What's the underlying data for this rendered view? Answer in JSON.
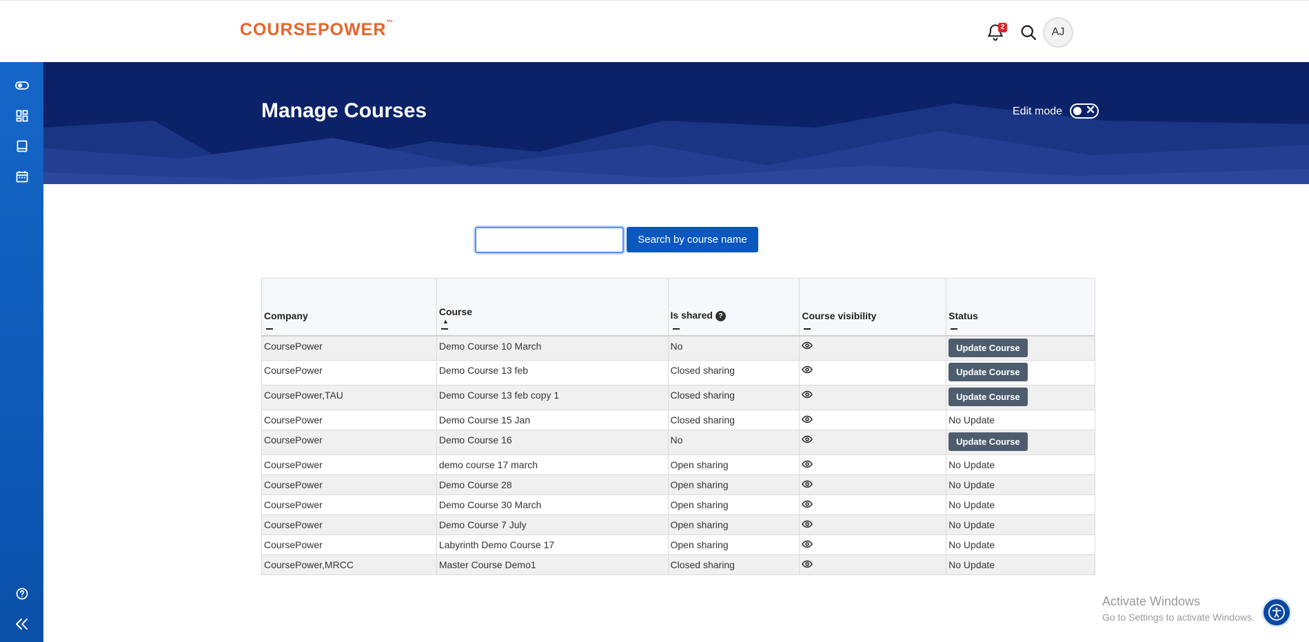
{
  "header": {
    "logo_text": "COURSEPOWER",
    "logo_tm": "™",
    "notification_count": "2",
    "user_initials": "AJ",
    "brand_color": "#e8632b"
  },
  "sidebar": {
    "icons": [
      "toggle-icon",
      "dashboard-icon",
      "book-icon",
      "calendar-icon",
      "help-icon",
      "collapse-icon"
    ]
  },
  "banner": {
    "title": "Manage Courses",
    "edit_mode_label": "Edit mode"
  },
  "search": {
    "placeholder": "",
    "button_label": "Search by course name"
  },
  "table": {
    "columns": [
      "Company",
      "Course",
      "Is shared",
      "Course visibility",
      "Status"
    ],
    "sorted_column": "Course",
    "rows": [
      {
        "company": "CoursePower",
        "course": "Demo Course 10 March",
        "shared": "No",
        "status": "Update Course",
        "status_button": true
      },
      {
        "company": "CoursePower",
        "course": "Demo Course 13 feb",
        "shared": "Closed sharing",
        "status": "Update Course",
        "status_button": true
      },
      {
        "company": "CoursePower,TAU",
        "course": "Demo Course 13 feb copy 1",
        "shared": "Closed sharing",
        "status": "Update Course",
        "status_button": true
      },
      {
        "company": "CoursePower",
        "course": "Demo Course 15 Jan",
        "shared": "Closed sharing",
        "status": "No Update",
        "status_button": false
      },
      {
        "company": "CoursePower",
        "course": "Demo Course 16",
        "shared": "No",
        "status": "Update Course",
        "status_button": true
      },
      {
        "company": "CoursePower",
        "course": "demo course 17 march",
        "shared": "Open sharing",
        "status": "No Update",
        "status_button": false
      },
      {
        "company": "CoursePower",
        "course": "Demo Course 28",
        "shared": "Open sharing",
        "status": "No Update",
        "status_button": false
      },
      {
        "company": "CoursePower",
        "course": "Demo Course 30 March",
        "shared": "Open sharing",
        "status": "No Update",
        "status_button": false
      },
      {
        "company": "CoursePower",
        "course": "Demo Course 7 July",
        "shared": "Open sharing",
        "status": "No Update",
        "status_button": false
      },
      {
        "company": "CoursePower",
        "course": "Labyrinth Demo Course 17",
        "shared": "Open sharing",
        "status": "No Update",
        "status_button": false
      },
      {
        "company": "CoursePower,MRCC",
        "course": "Master Course Demo1",
        "shared": "Closed sharing",
        "status": "No Update",
        "status_button": false
      }
    ]
  },
  "watermark": {
    "line1": "Activate Windows",
    "line2": "Go to Settings to activate Windows."
  }
}
